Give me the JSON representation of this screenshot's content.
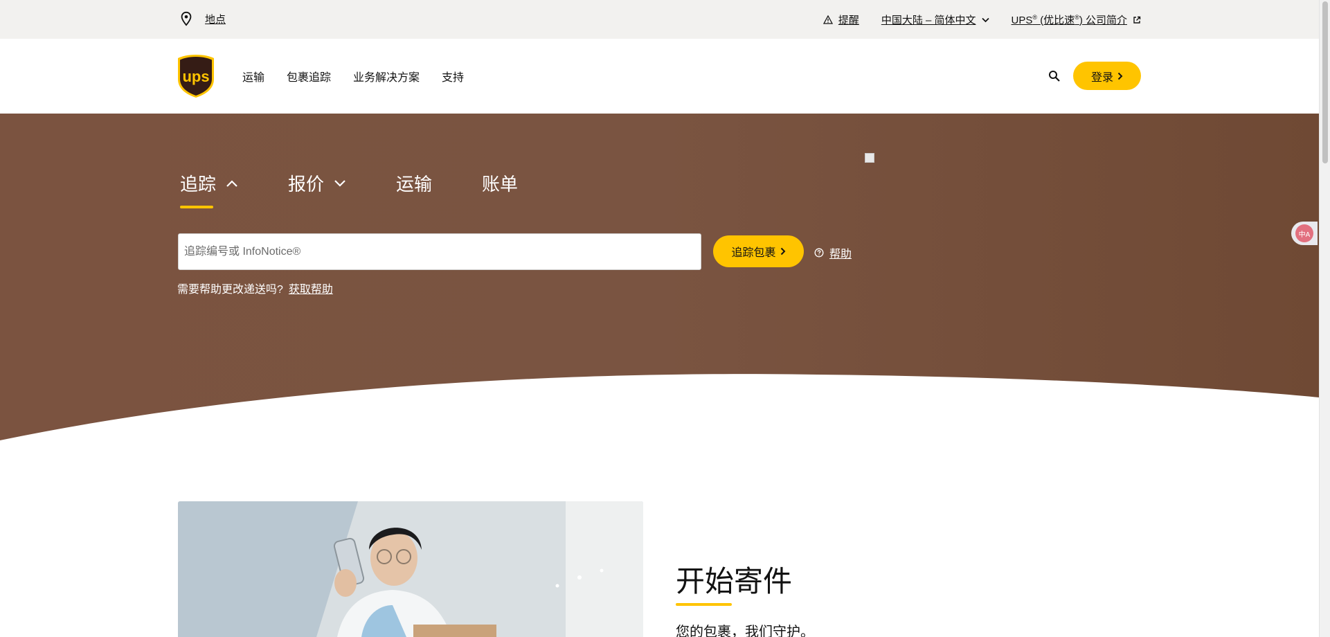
{
  "utility": {
    "locations": "地点",
    "alerts": "提醒",
    "region": "中国大陆 – 简体中文",
    "about_prefix": "UPS",
    "about_mid": "(优比速",
    "about_suffix": ") 公司简介",
    "reg": "®"
  },
  "header": {
    "logo_text": "ups",
    "nav": [
      "运输",
      "包裹追踪",
      "业务解决方案",
      "支持"
    ],
    "login": "登录"
  },
  "hero": {
    "tabs": [
      {
        "label": "追踪",
        "active": true
      },
      {
        "label": "报价",
        "active": false
      },
      {
        "label": "运输",
        "active": false
      },
      {
        "label": "账单",
        "active": false
      }
    ],
    "track_placeholder": "追踪编号或 InfoNotice®",
    "track_button": "追踪包裹",
    "help": "帮助",
    "change_text": "需要帮助更改递送吗?",
    "change_link": "获取帮助"
  },
  "section": {
    "title": "开始寄件",
    "subtitle": "您的包裹，我们守护。"
  },
  "widget": {
    "label": "中A"
  },
  "colors": {
    "brand_yellow": "#ffc400",
    "hero_brown": "#7b5340",
    "logo_brown": "#351c15"
  }
}
